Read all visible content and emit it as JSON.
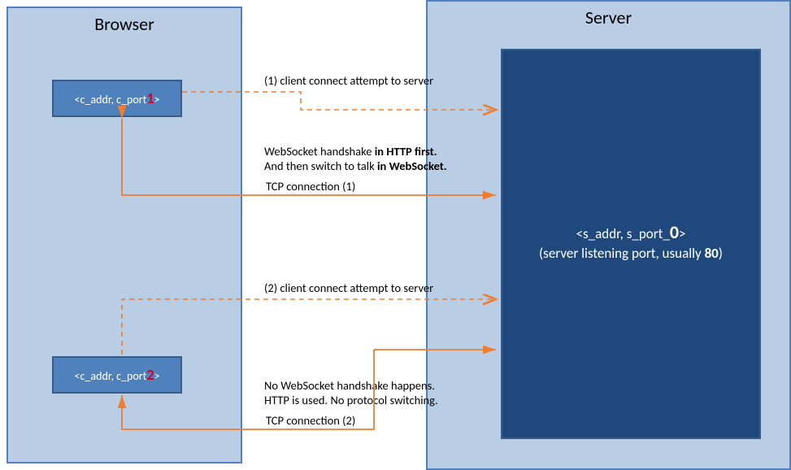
{
  "browser": {
    "title": "Browser",
    "client1": {
      "addr": "<c_addr, c_port",
      "num": "1",
      "suffix": ">"
    },
    "client2": {
      "addr": "<c_addr, c_port",
      "num": "2",
      "suffix": ">"
    }
  },
  "server": {
    "title": "Server",
    "line1_prefix": "<s_addr, s_port_",
    "line1_zero": "0",
    "line1_suffix": ">",
    "line2_prefix": "(server listening port, usually ",
    "line2_bold": "80",
    "line2_suffix": ")"
  },
  "annotations": {
    "attempt1": "(1) client connect attempt to server",
    "ws_a": "WebSocket handshake ",
    "ws_a_bold": "in HTTP first.",
    "ws_b": "And then switch to talk ",
    "ws_b_bold": "in WebSocket.",
    "tcp1": "TCP connection (1)",
    "attempt2": "(2) client connect attempt to server",
    "nows_a": "No WebSocket handshake happens.",
    "nows_b": "HTTP is used. No protocol switching.",
    "tcp2": "TCP connection (2)"
  }
}
